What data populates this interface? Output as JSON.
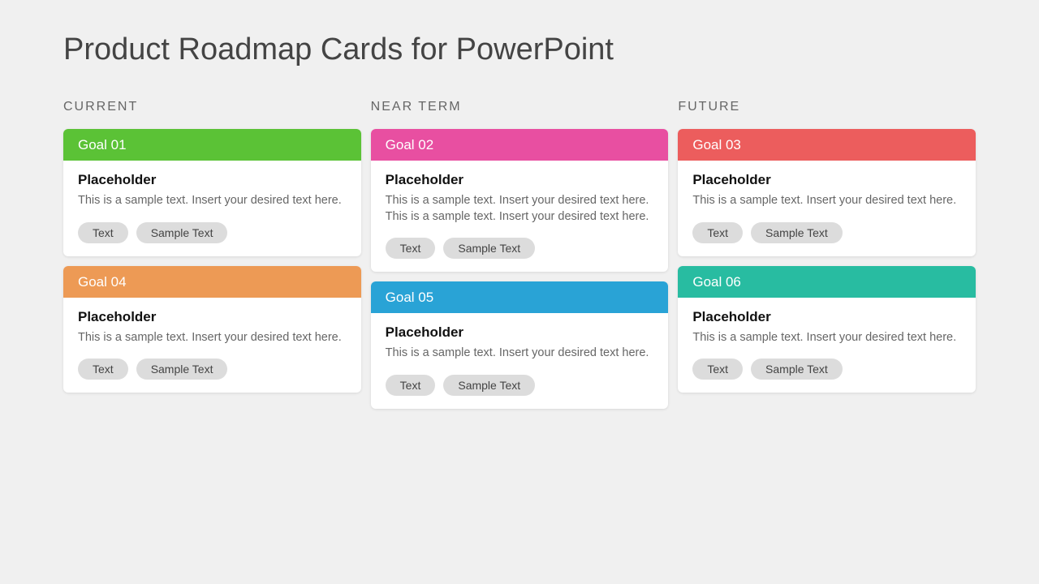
{
  "title": "Product Roadmap Cards for PowerPoint",
  "columns": [
    {
      "header": "CURRENT",
      "cards": [
        {
          "goal": "Goal 01",
          "color": "#5bc236",
          "subtitle": "Placeholder",
          "text": "This is a sample text. Insert your desired text here.",
          "tags": [
            "Text",
            "Sample Text"
          ]
        },
        {
          "goal": "Goal 04",
          "color": "#ed9a55",
          "subtitle": "Placeholder",
          "text": "This is a sample text. Insert your desired text here.",
          "tags": [
            "Text",
            "Sample Text"
          ]
        }
      ]
    },
    {
      "header": "NEAR TERM",
      "cards": [
        {
          "goal": "Goal 02",
          "color": "#e84fa1",
          "subtitle": "Placeholder",
          "text": "This is a sample text. Insert your desired text here. This is a sample text. Insert your desired text here.",
          "tags": [
            "Text",
            "Sample Text"
          ]
        },
        {
          "goal": "Goal 05",
          "color": "#29a3d6",
          "subtitle": "Placeholder",
          "text": "This is a sample text. Insert your desired text here.",
          "tags": [
            "Text",
            "Sample Text"
          ]
        }
      ]
    },
    {
      "header": "FUTURE",
      "cards": [
        {
          "goal": "Goal 03",
          "color": "#ec5d5d",
          "subtitle": "Placeholder",
          "text": "This is a sample text. Insert your desired text here.",
          "tags": [
            "Text",
            "Sample Text"
          ]
        },
        {
          "goal": "Goal 06",
          "color": "#28bca1",
          "subtitle": "Placeholder",
          "text": "This is a sample text. Insert your desired text here.",
          "tags": [
            "Text",
            "Sample Text"
          ]
        }
      ]
    }
  ]
}
